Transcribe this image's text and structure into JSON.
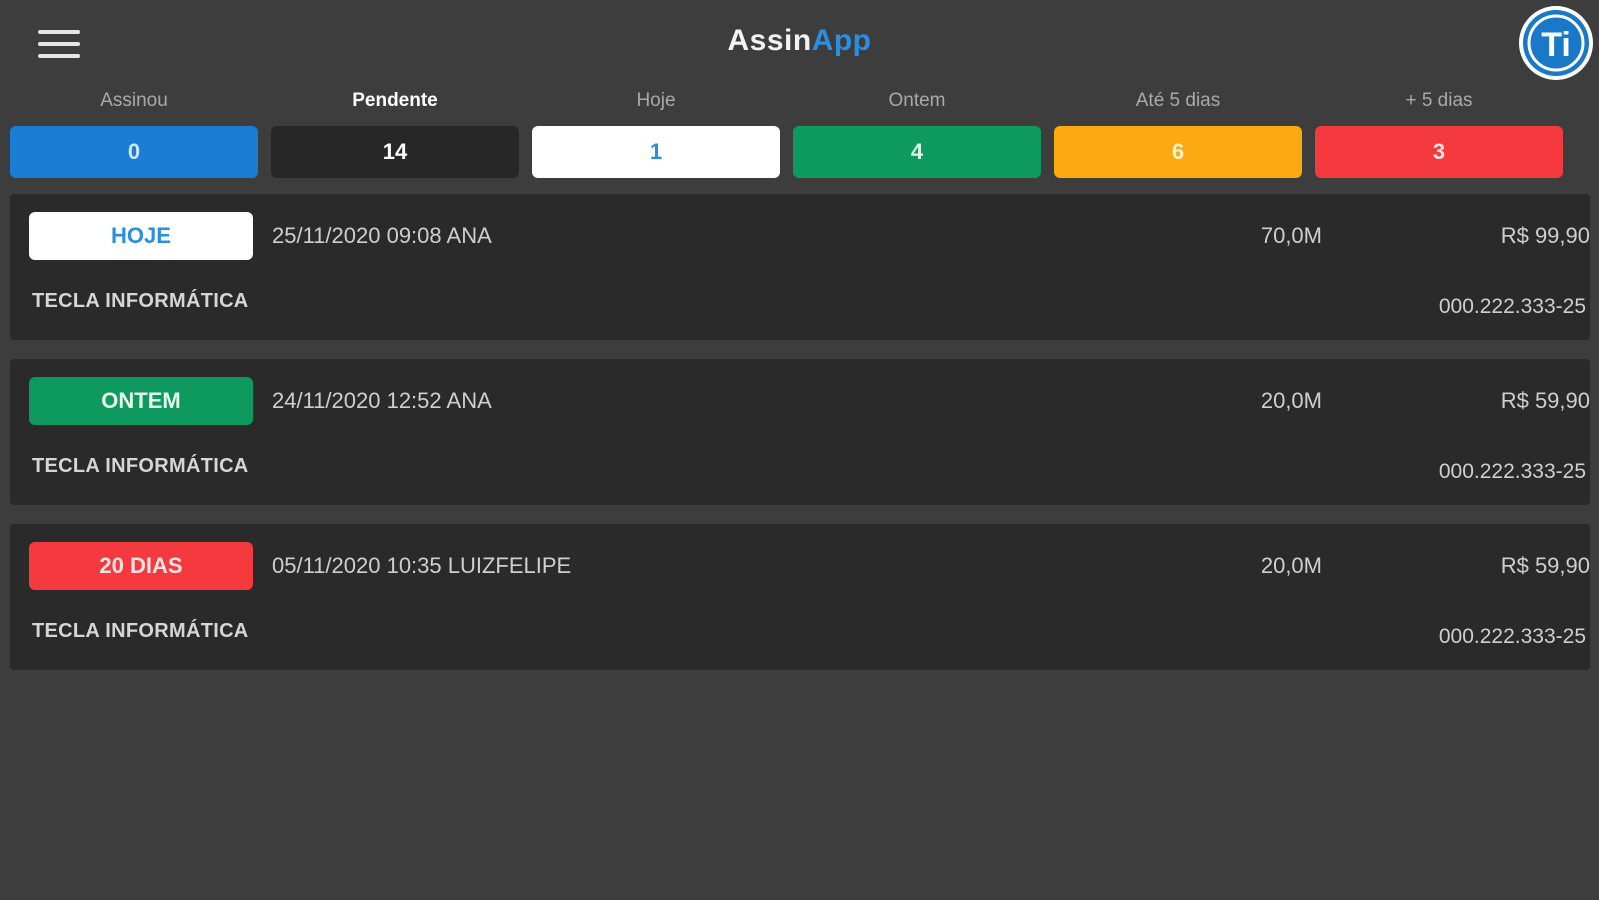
{
  "header": {
    "title_part1": "Assin",
    "title_part2": "App",
    "logo_text": "Ti",
    "colors": {
      "title_accent": "#2a8fe0",
      "logo_blue": "#1a78c8"
    }
  },
  "tabs": [
    {
      "label": "Assinou",
      "count": "0",
      "bg": "#1a7fd4",
      "fg": "#cfe6fa"
    },
    {
      "label": "Pendente",
      "count": "14",
      "bg": "#272727",
      "fg": "#ffffff"
    },
    {
      "label": "Hoje",
      "count": "1",
      "bg": "#ffffff",
      "fg": "#2a8fe0"
    },
    {
      "label": "Ontem",
      "count": "4",
      "bg": "#0e9a5e",
      "fg": "#d9f3e6"
    },
    {
      "label": "Até 5 dias",
      "count": "6",
      "bg": "#fca912",
      "fg": "#fff3d6"
    },
    {
      "label": "+ 5 dias",
      "count": "3",
      "bg": "#f53a3f",
      "fg": "#ffe1e1"
    }
  ],
  "items": [
    {
      "badge": "HOJE",
      "badge_bg": "#ffffff",
      "badge_fg": "#2a8fe0",
      "info": "25/11/2020 09:08 ANA",
      "size": "70,0M",
      "price": "R$ 99,90",
      "company": "TECLA INFORMÁTICA",
      "doc": "000.222.333-25"
    },
    {
      "badge": "ONTEM",
      "badge_bg": "#0e9a5e",
      "badge_fg": "#e6f7ee",
      "info": "24/11/2020 12:52 ANA",
      "size": "20,0M",
      "price": "R$ 59,90",
      "company": "TECLA INFORMÁTICA",
      "doc": "000.222.333-25"
    },
    {
      "badge": "20 DIAS",
      "badge_bg": "#f53a3f",
      "badge_fg": "#ffe4e4",
      "info": "05/11/2020 10:35 LUIZFELIPE",
      "size": "20,0M",
      "price": "R$ 59,90",
      "company": "TECLA INFORMÁTICA",
      "doc": "000.222.333-25"
    }
  ]
}
